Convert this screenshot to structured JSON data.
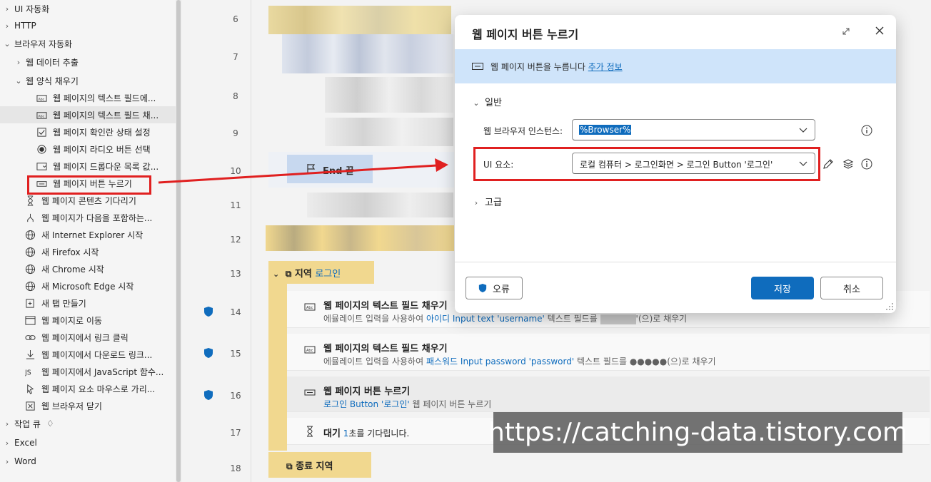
{
  "sidebar": {
    "items": [
      {
        "label": "UI 자동화",
        "level": 0,
        "expander": "collapsed"
      },
      {
        "label": "HTTP",
        "level": 0,
        "expander": "collapsed"
      },
      {
        "label": "브라우저 자동화",
        "level": 0,
        "expander": "expanded"
      },
      {
        "label": "웹 데이터 추출",
        "level": 1,
        "expander": "collapsed"
      },
      {
        "label": "웹 양식 채우기",
        "level": 1,
        "expander": "expanded"
      },
      {
        "label": "웹 페이지의 텍스트 필드에...",
        "level": 2,
        "icon": "textfield-icon"
      },
      {
        "label": "웹 페이지의 텍스트 필드 채...",
        "level": 2,
        "icon": "textfield-icon",
        "selected": true
      },
      {
        "label": "웹 페이지 확인란 상태 설정",
        "level": 2,
        "icon": "checkbox-icon"
      },
      {
        "label": "웹 페이지 라디오 버튼 선택",
        "level": 2,
        "icon": "radio-icon"
      },
      {
        "label": "웹 페이지 드롭다운 목록 값...",
        "level": 2,
        "icon": "dropdown-icon"
      },
      {
        "label": "웹 페이지 버튼 누르기",
        "level": 2,
        "icon": "button-icon",
        "highlighted": true
      },
      {
        "label": "웹 페이지 콘텐츠 기다리기",
        "level": 1,
        "icon": "hourglass-icon"
      },
      {
        "label": "웹 페이지가 다음을 포함하는...",
        "level": 1,
        "icon": "branch-icon"
      },
      {
        "label": "새 Internet Explorer 시작",
        "level": 1,
        "icon": "globe-icon"
      },
      {
        "label": "새 Firefox 시작",
        "level": 1,
        "icon": "globe-icon"
      },
      {
        "label": "새 Chrome 시작",
        "level": 1,
        "icon": "globe-icon"
      },
      {
        "label": "새 Microsoft Edge 시작",
        "level": 1,
        "icon": "globe-icon"
      },
      {
        "label": "새 탭 만들기",
        "level": 1,
        "icon": "new-tab-icon"
      },
      {
        "label": "웹 페이지로 이동",
        "level": 1,
        "icon": "window-icon"
      },
      {
        "label": "웹 페이지에서 링크 클릭",
        "level": 1,
        "icon": "link-icon"
      },
      {
        "label": "웹 페이지에서 다운로드 링크...",
        "level": 1,
        "icon": "download-icon"
      },
      {
        "label": "웹 페이지에서 JavaScript 함수...",
        "level": 1,
        "icon": "js-icon"
      },
      {
        "label": "웹 페이지 요소 마우스로 가리...",
        "level": 1,
        "icon": "pointer-icon"
      },
      {
        "label": "웹 브라우저 닫기",
        "level": 1,
        "icon": "close-box-icon"
      },
      {
        "label": "작업 큐",
        "level": 0,
        "expander": "collapsed",
        "premium": true
      },
      {
        "label": "Excel",
        "level": 0,
        "expander": "collapsed"
      },
      {
        "label": "Word",
        "level": 0,
        "expander": "collapsed"
      }
    ]
  },
  "flow": {
    "line_numbers": [
      "6",
      "7",
      "8",
      "9",
      "10",
      "11",
      "12",
      "13",
      "14",
      "15",
      "16",
      "17",
      "18"
    ],
    "end_label": "End 끝",
    "region_start": {
      "keyword": "지역",
      "name": "로그인"
    },
    "region_end": {
      "label": "종료 지역"
    },
    "steps": [
      {
        "line": "14",
        "title": "웹 페이지의 텍스트 필드 채우기",
        "desc_pre": "에뮬레이트 입력을 사용하여 ",
        "desc_link": "아이디 Input text 'username'",
        "desc_mid": " 텍스트 필드를 ",
        "desc_post": "'(으)로 채우기"
      },
      {
        "line": "15",
        "title": "웹 페이지의 텍스트 필드 채우기",
        "desc_pre": "에뮬레이트 입력을 사용하여 ",
        "desc_link": "패스워드 Input password 'password'",
        "desc_post": " 텍스트 필드를 ●●●●●(으)로 채우기"
      },
      {
        "line": "16",
        "title": "웹 페이지 버튼 누르기",
        "desc_link": "로그인 Button '로그인'",
        "desc_post": " 웹 페이지 버튼 누르기"
      },
      {
        "line": "17",
        "title_bold": "대기",
        "title_num": "1",
        "title_rest": "초를 기다립니다."
      }
    ]
  },
  "dialog": {
    "title": "웹 페이지 버튼 누르기",
    "banner_text": "웹 페이지 버튼을 누릅니다",
    "banner_link": "추가 정보",
    "section_general": "일반",
    "browser_label": "웹 브라우저 인스턴스:",
    "browser_value": "%Browser%",
    "ui_label": "UI 요소:",
    "ui_value": "로컬 컴퓨터 > 로그인화면 > 로그인 Button '로그인'",
    "section_advanced": "고급",
    "error_button": "오류",
    "save_button": "저장",
    "cancel_button": "취소"
  },
  "watermark": "https://catching-data.tistory.com",
  "colors": {
    "accent": "#0f6cbd",
    "highlight_red": "#e02020",
    "region_yellow": "#f1d88f",
    "banner_blue": "#cfe4fa"
  }
}
